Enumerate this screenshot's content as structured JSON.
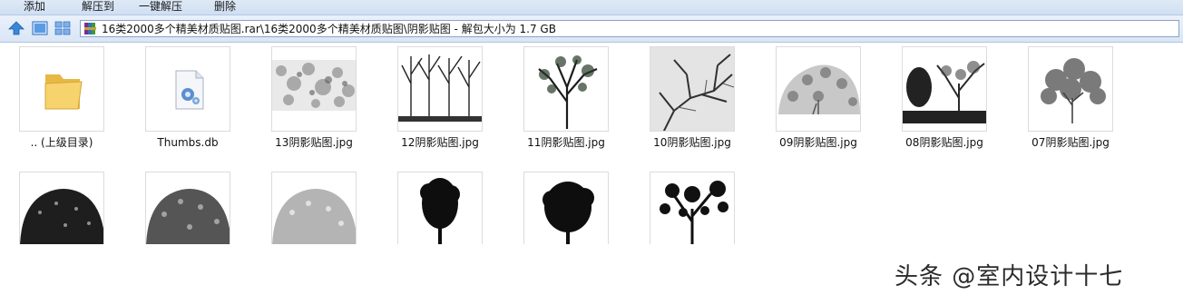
{
  "toolbar": {
    "add": "添加",
    "extract_to": "解压到",
    "one_click_extract": "一键解压",
    "delete": "删除"
  },
  "address": {
    "path": "16类2000多个精美材质贴图.rar\\16类2000多个精美材质贴图\\阴影贴图 - 解包大小为 1.7 GB"
  },
  "files": [
    {
      "name": ".. (上级目录)",
      "kind": "folder-icon"
    },
    {
      "name": "Thumbs.db",
      "kind": "db-file-icon"
    },
    {
      "name": "13阴影贴图.jpg",
      "kind": "texture-thumbnail"
    },
    {
      "name": "12阴影贴图.jpg",
      "kind": "tree-thumbnail"
    },
    {
      "name": "11阴影贴图.jpg",
      "kind": "tree-thumbnail"
    },
    {
      "name": "10阴影贴图.jpg",
      "kind": "tree-thumbnail"
    },
    {
      "name": "09阴影贴图.jpg",
      "kind": "tree-thumbnail"
    },
    {
      "name": "08阴影贴图.jpg",
      "kind": "tree-thumbnail"
    },
    {
      "name": "07阴影贴图.jpg",
      "kind": "tree-thumbnail"
    }
  ],
  "watermark": "头条 @室内设计十七",
  "colors": {
    "toolbar_bg": "#dfe9f7",
    "path_border": "#8aa4c8",
    "folder": "#f3cc59"
  }
}
